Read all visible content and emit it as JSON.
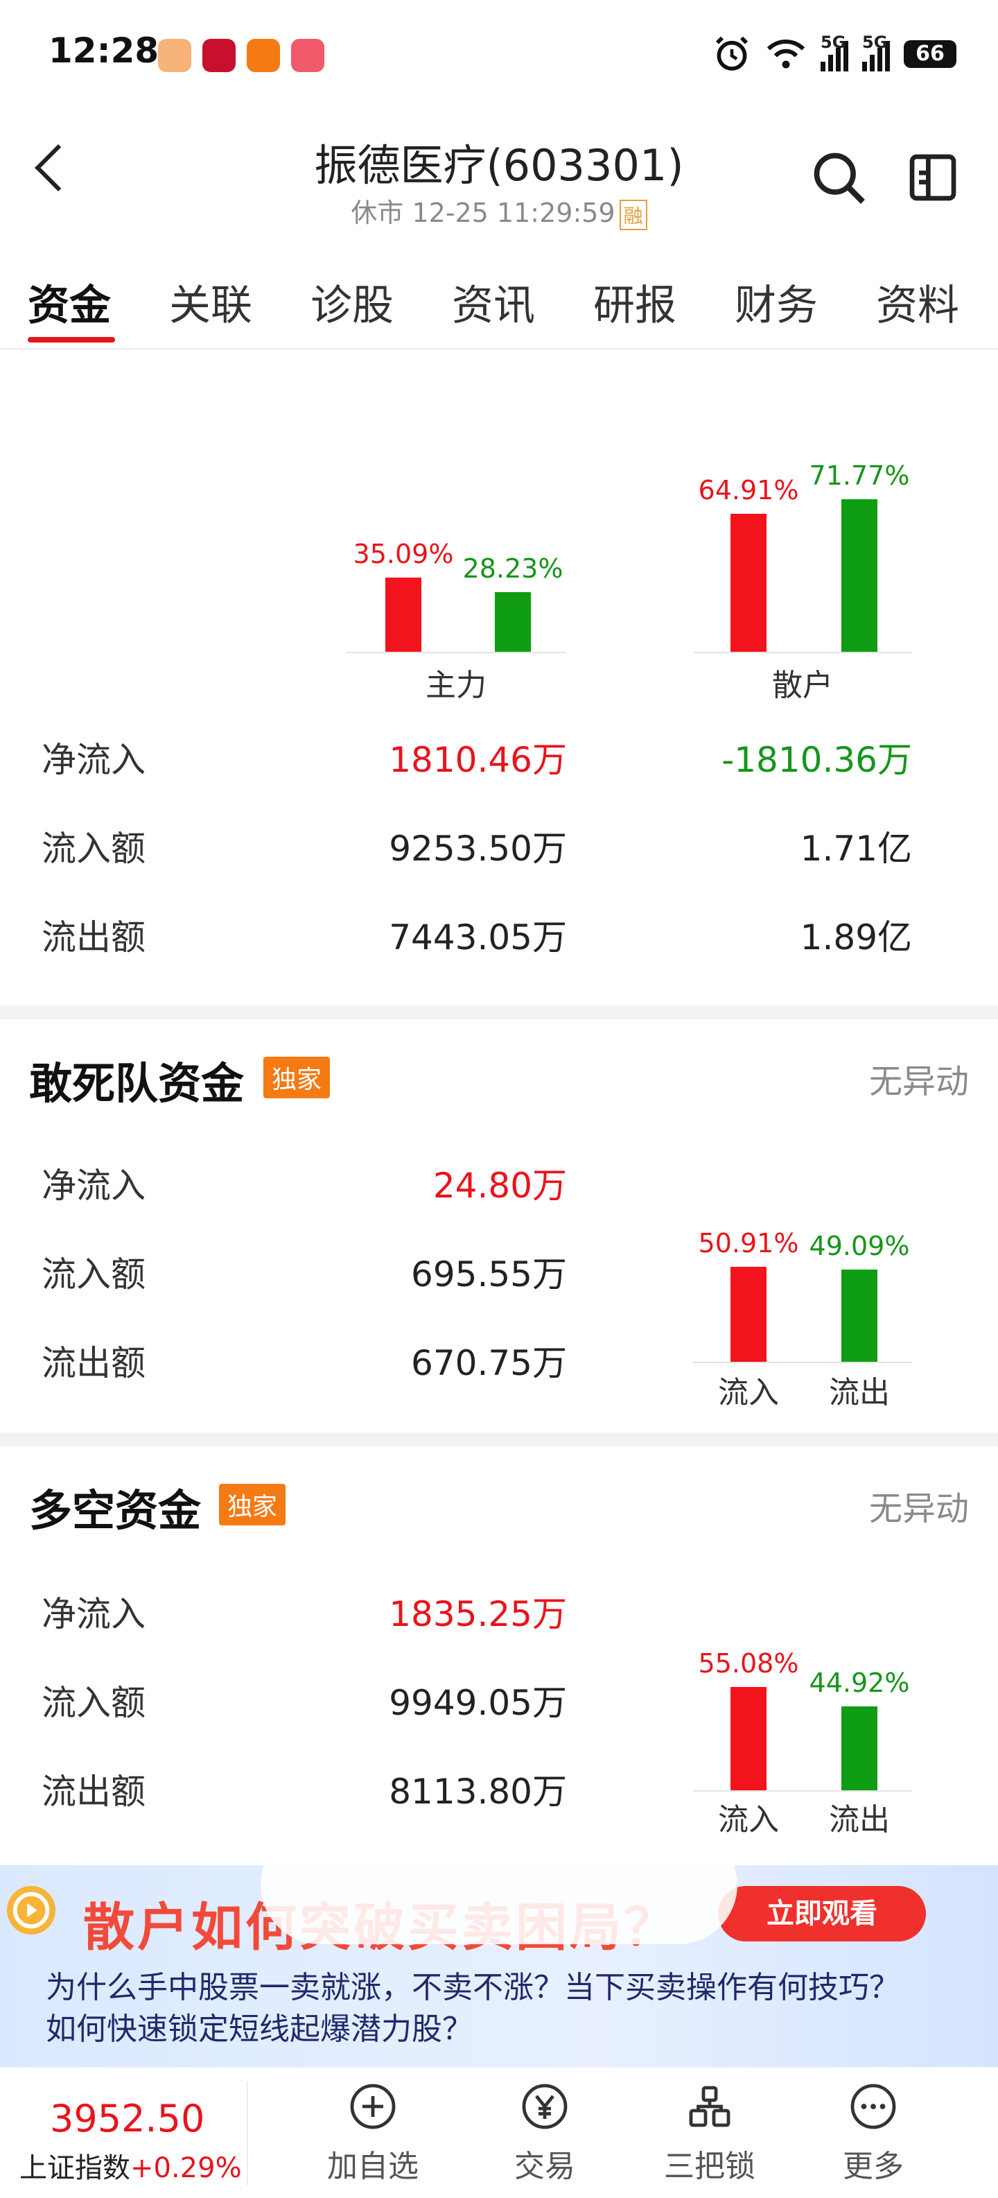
{
  "status_bar": {
    "time": "12:28",
    "battery": "66",
    "network1": "5G",
    "network2": "5G"
  },
  "header": {
    "title": "振德医疗(603301)",
    "subtitle": "休市 12-25 11:29:59",
    "badge": "融"
  },
  "tabs": [
    "资金",
    "关联",
    "诊股",
    "资讯",
    "研报",
    "财务",
    "资料"
  ],
  "flow": {
    "chart": {
      "groups": [
        {
          "label": "主力",
          "in_pct": "35.09%",
          "out_pct": "28.23%",
          "in_value": 35.09,
          "out_value": 28.23
        },
        {
          "label": "散户",
          "in_pct": "64.91%",
          "out_pct": "71.77%",
          "in_value": 64.91,
          "out_value": 71.77
        }
      ]
    },
    "rows": [
      {
        "label": "净流入",
        "main": "1810.46万",
        "retail": "-1810.36万"
      },
      {
        "label": "流入额",
        "main": "9253.50万",
        "retail": "1.71亿"
      },
      {
        "label": "流出额",
        "main": "7443.05万",
        "retail": "1.89亿"
      }
    ]
  },
  "dare_fund": {
    "title": "敢死队资金",
    "badge": "独家",
    "status": "无异动",
    "rows": [
      {
        "label": "净流入",
        "value": "24.80万"
      },
      {
        "label": "流入额",
        "value": "695.55万"
      },
      {
        "label": "流出额",
        "value": "670.75万"
      }
    ],
    "chart": {
      "in_pct": "50.91%",
      "out_pct": "49.09%",
      "in_value": 50.91,
      "out_value": 49.09,
      "in_label": "流入",
      "out_label": "流出"
    }
  },
  "longshort_fund": {
    "title": "多空资金",
    "badge": "独家",
    "status": "无异动",
    "rows": [
      {
        "label": "净流入",
        "value": "1835.25万"
      },
      {
        "label": "流入额",
        "value": "9949.05万"
      },
      {
        "label": "流出额",
        "value": "8113.80万"
      }
    ],
    "chart": {
      "in_pct": "55.08%",
      "out_pct": "44.92%",
      "in_value": 55.08,
      "out_value": 44.92,
      "in_label": "流入",
      "out_label": "流出"
    }
  },
  "banner": {
    "headline": "散户如何突破买卖困局？",
    "button": "立即观看",
    "line1": "为什么手中股票一卖就涨，不卖不涨？当下买卖操作有何技巧？",
    "line2": "如何快速锁定短线起爆潜力股？"
  },
  "bottom_bar": {
    "index_value": "3952.50",
    "index_name": "上证指数",
    "index_change": "+0.29%",
    "items": [
      "加自选",
      "交易",
      "三把锁",
      "更多"
    ]
  },
  "colors": {
    "up": "#e8141c",
    "down": "#16951b",
    "accent": "#e8141c",
    "badge": "#f47a14"
  }
}
